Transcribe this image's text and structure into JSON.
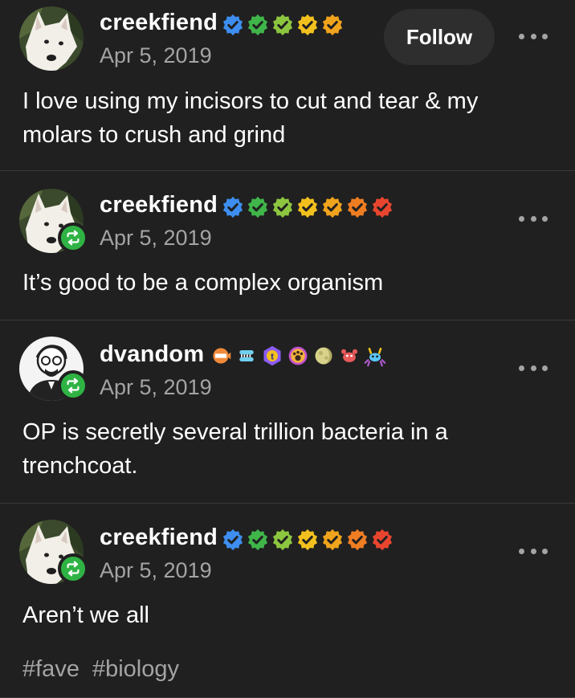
{
  "posts": [
    {
      "username": "creekfiend",
      "date": "Apr 5, 2019",
      "text": "I love using my incisors to cut and tear & my molars to crush and grind",
      "follow_label": "Follow"
    },
    {
      "username": "creekfiend",
      "date": "Apr 5, 2019",
      "text": "It’s good to be a complex organism"
    },
    {
      "username": "dvandom",
      "date": "Apr 5, 2019",
      "text": "OP is secretly several trillion bacteria in a trenchcoat."
    },
    {
      "username": "creekfiend",
      "date": "Apr 5, 2019",
      "text": "Aren’t we all",
      "tags": [
        "#fave",
        "#biology"
      ]
    }
  ],
  "colors": {
    "background": "#202020",
    "text": "#ffffff",
    "muted": "#a4a4a4",
    "reblog_green": "#2fb344",
    "badge_blue": "#3d8ef0",
    "badge_green": "#3fb54a",
    "badge_lime": "#8cc63f",
    "badge_yellow": "#f2c01e",
    "badge_gold": "#f0a31c",
    "badge_orange": "#ef7d22",
    "badge_red": "#e8452f"
  },
  "icons": {
    "verified": "checkmark-badge-icon",
    "reblog": "reblog-icon",
    "more": "ellipsis-icon"
  }
}
